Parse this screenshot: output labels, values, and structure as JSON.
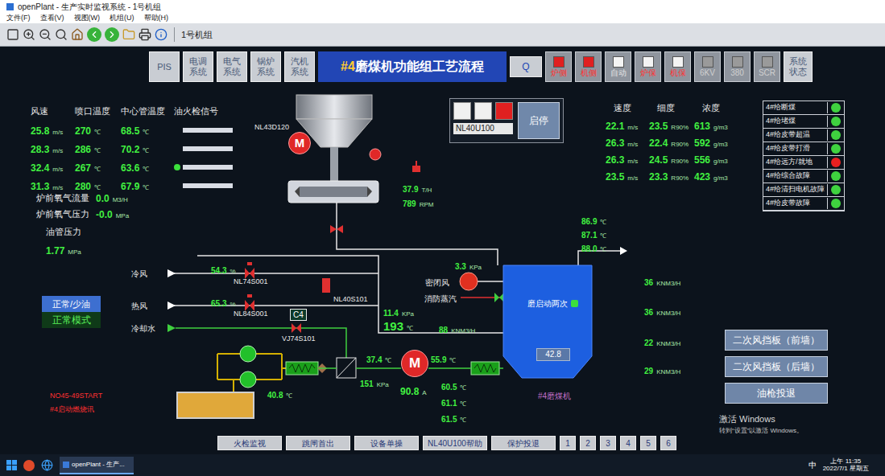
{
  "window": {
    "title": "openPlant - 生产实时监视系统 - 1号机组",
    "menu": [
      "文件(F)",
      "查看(V)",
      "视图(W)",
      "机组(U)",
      "帮助(H)"
    ],
    "unit_label": "1号机组"
  },
  "nav": {
    "buttons": [
      "PIS",
      "电调系统",
      "电气系统",
      "锅炉系统",
      "汽机系统"
    ],
    "title_prefix": "#4",
    "title": "磨煤机功能组工艺流程",
    "search": "Q",
    "indicators": [
      {
        "label": "炉侧",
        "color": "#e02020",
        "label_color": "#ff3030"
      },
      {
        "label": "机侧",
        "color": "#e02020",
        "label_color": "#ff3030"
      },
      {
        "label": "自动",
        "color": "#f4f4f4",
        "label_color": "#e6e6e6"
      },
      {
        "label": "炉保",
        "color": "#f4f4f4",
        "label_color": "#ff3030"
      },
      {
        "label": "机保",
        "color": "#f4f4f4",
        "label_color": "#ff3030"
      },
      {
        "label": "6KV",
        "color": "#9a9a9a",
        "label_color": "#d0d0d0"
      },
      {
        "label": "380",
        "color": "#9a9a9a",
        "label_color": "#d0d0d0"
      },
      {
        "label": "SCR",
        "color": "#9a9a9a",
        "label_color": "#d0d0d0"
      }
    ],
    "status_button": "系统状态"
  },
  "left_table": {
    "headers": [
      "风速",
      "喷口温度",
      "中心管温度",
      "油火检信号"
    ],
    "speed_unit": "m/s",
    "temp_unit": "℃",
    "rows": [
      {
        "speed": "25.8",
        "nozzle": "270",
        "center": "68.5",
        "flame": false
      },
      {
        "speed": "28.3",
        "nozzle": "286",
        "center": "70.2",
        "flame": false
      },
      {
        "speed": "32.4",
        "nozzle": "267",
        "center": "63.6",
        "flame": true
      },
      {
        "speed": "31.3",
        "nozzle": "280",
        "center": "67.9",
        "flame": false
      }
    ]
  },
  "oxygen": [
    {
      "label": "炉前氧气流量",
      "value": "0.0",
      "unit": "M3/H"
    },
    {
      "label": "炉前氧气压力",
      "value": "-0.0",
      "unit": "MPa"
    }
  ],
  "oil": {
    "label": "油管压力",
    "value": "1.77",
    "unit": "MPa"
  },
  "right_table": {
    "headers": [
      "速度",
      "细度",
      "浓度"
    ],
    "units": [
      "m/s",
      "R90%",
      "g/m3"
    ],
    "rows": [
      {
        "speed": "22.1",
        "fineness": "23.5",
        "conc": "613"
      },
      {
        "speed": "26.3",
        "fineness": "22.4",
        "conc": "592"
      },
      {
        "speed": "26.3",
        "fineness": "24.5",
        "conc": "556"
      },
      {
        "speed": "23.5",
        "fineness": "23.3",
        "conc": "423"
      }
    ]
  },
  "status_list": [
    {
      "label": "4#给断煤",
      "color": "#3fd23f"
    },
    {
      "label": "4#给堵煤",
      "color": "#3fd23f"
    },
    {
      "label": "4#给皮带超温",
      "color": "#3fd23f"
    },
    {
      "label": "4#给皮带打滑",
      "color": "#3fd23f"
    },
    {
      "label": "4#给远方/就地",
      "color": "#e82020"
    },
    {
      "label": "4#给综合故障",
      "color": "#3fd23f"
    },
    {
      "label": "4#给清扫电机故障",
      "color": "#3fd23f"
    },
    {
      "label": "4#给皮带故障",
      "color": "#3fd23f"
    }
  ],
  "control": {
    "states": [
      {
        "color": "#f0f0f0"
      },
      {
        "color": "#f0f0f0"
      },
      {
        "color": "#e02020"
      }
    ],
    "tag": "NL40U100",
    "button": "启停"
  },
  "mode": {
    "label": "正常/少油",
    "value": "正常模式"
  },
  "alarms": [
    "NO45-49START",
    "#4启动燃烧讯"
  ],
  "side_buttons": [
    "二次风挡板（前墙）",
    "二次风挡板（后墙）",
    "油枪投退"
  ],
  "bottom": {
    "buttons": [
      "火检监视",
      "跳闸首出",
      "设备单操",
      "NL40U100帮助",
      "保护投退"
    ],
    "pages": [
      "1",
      "2",
      "3",
      "4",
      "5",
      "6"
    ]
  },
  "diagram": {
    "hopper_tag": "NL43D120",
    "motor_label": "M",
    "feeder": {
      "flow": "37.9",
      "flow_unit": "T/H",
      "speed": "789",
      "speed_unit": "RPM"
    },
    "outlet_temps": [
      {
        "value": "86.9",
        "unit": "℃"
      },
      {
        "value": "87.1",
        "unit": "℃"
      },
      {
        "value": "88.0",
        "unit": "℃"
      }
    ],
    "air_flows": [
      {
        "value": "36",
        "unit": "KNM3/H"
      },
      {
        "value": "36",
        "unit": "KNM3/H"
      },
      {
        "value": "22",
        "unit": "KNM3/H"
      },
      {
        "value": "29",
        "unit": "KNM3/H"
      }
    ],
    "lines": {
      "cold_air": "冷风",
      "hot_air": "热风",
      "cooling_water": "冷却水"
    },
    "cold_damper": {
      "value": "54.3",
      "unit": "%",
      "tag": "NL74S001"
    },
    "hot_damper": {
      "value": "65.3",
      "unit": "%",
      "tag": "NL84S001"
    },
    "valve_tag": "NL40S101",
    "c4": "C4",
    "water_valve": "VJ74S101",
    "inlet": {
      "pressure": "11.4",
      "pressure_unit": "KPa",
      "temp": "193",
      "temp_unit": "℃",
      "flow": "88",
      "flow_unit": "KNM3/H"
    },
    "seal": {
      "pressure": "3.3",
      "unit": "KPa",
      "label": "密闭风",
      "steam": "消防蒸汽"
    },
    "mill": {
      "status": "磨启动两次",
      "status_on": true,
      "reading": "42.8",
      "name": "#4磨煤机"
    },
    "lube": {
      "tank_temp": "40.8",
      "cooler_temp": "37.4",
      "pressure": "151",
      "pressure_unit": "KPa",
      "motor_temp": "55.9",
      "current": "90.8",
      "current_unit": "A",
      "bearing_temps": [
        "60.5",
        "61.1",
        "61.5"
      ],
      "temp_unit": "℃"
    }
  },
  "watermark": {
    "title": "激活 Windows",
    "hint": "转到“设置”以激活 Windows。"
  },
  "taskbar": {
    "app": "openPlant - 生产...",
    "ime": "中",
    "time": "上午 11:35",
    "date": "2022/7/1 星期五"
  }
}
